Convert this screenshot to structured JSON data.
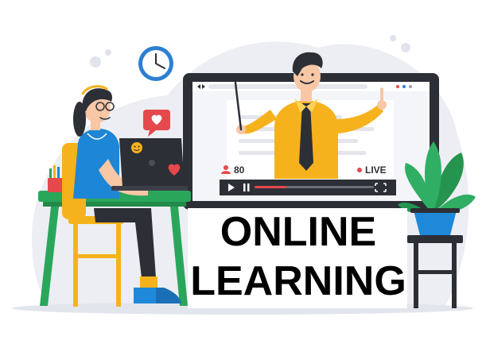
{
  "headline": {
    "line1": "ONLINE",
    "line2": "LEARNING"
  },
  "video_player": {
    "viewer_count": "80",
    "live_label": "LIVE"
  },
  "icons": {
    "clock": "clock-icon",
    "heart_bubble": "heart-bubble-icon",
    "user": "user-icon",
    "live_dot": "live-dot-icon",
    "play": "play-icon",
    "pause": "pause-icon",
    "fullscreen": "fullscreen-icon",
    "smiley_sticker": "smiley-icon",
    "heart_sticker": "heart-icon"
  },
  "colors": {
    "background_blob": "#eceef3",
    "monitor_frame": "#2d2f36",
    "screen": "#ffffff",
    "teacher_shirt": "#f5b21c",
    "student_top": "#1e86d6",
    "desk_green": "#2aa65b",
    "plant_green": "#2fae64",
    "pot_blue": "#1f88d9",
    "heart_red": "#e5484d",
    "clock_blue": "#2d7fd3"
  }
}
